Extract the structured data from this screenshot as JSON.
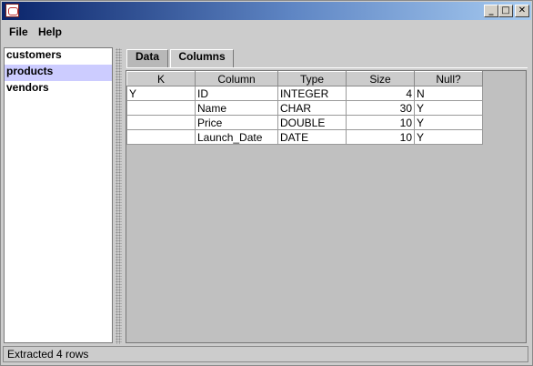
{
  "window": {
    "min_glyph": "_",
    "max_glyph": "□",
    "close_glyph": "✕"
  },
  "menu": {
    "file": "File",
    "help": "Help"
  },
  "tables_list": {
    "items": [
      "customers",
      "products",
      "vendors"
    ],
    "selected": "products"
  },
  "tabs": {
    "data": "Data",
    "columns": "Columns",
    "active": "Columns"
  },
  "columns_table": {
    "headers": [
      "K",
      "Column",
      "Type",
      "Size",
      "Null?"
    ],
    "rows": [
      [
        "Y",
        "ID",
        "INTEGER",
        "4",
        "N"
      ],
      [
        "",
        "Name",
        "CHAR",
        "30",
        "Y"
      ],
      [
        "",
        "Price",
        "DOUBLE",
        "10",
        "Y"
      ],
      [
        "",
        "Launch_Date",
        "DATE",
        "10",
        "Y"
      ]
    ]
  },
  "status": {
    "text": "Extracted 4 rows"
  }
}
